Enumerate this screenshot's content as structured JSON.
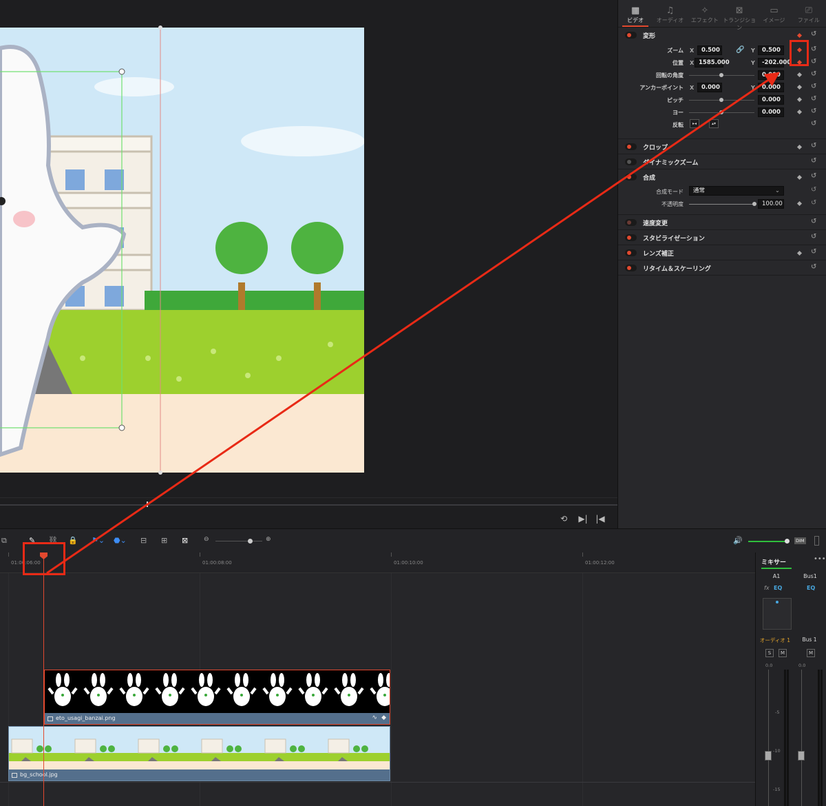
{
  "inspector": {
    "tabs": [
      {
        "label": "ビデオ",
        "icon": "film-icon",
        "active": true
      },
      {
        "label": "オーディオ",
        "icon": "music-note-icon",
        "active": false
      },
      {
        "label": "エフェクト",
        "icon": "magic-wand-icon",
        "active": false
      },
      {
        "label": "トランジション",
        "icon": "transition-icon",
        "active": false
      },
      {
        "label": "イメージ",
        "icon": "image-icon",
        "active": false
      },
      {
        "label": "ファイル",
        "icon": "file-icon",
        "active": false
      }
    ],
    "transform": {
      "title": "変形",
      "zoom_label": "ズーム",
      "zoom_x": "0.500",
      "zoom_y": "0.500",
      "position_label": "位置",
      "position_x": "1585.000",
      "position_y": "-202.000",
      "rotation_label": "回転の角度",
      "rotation": "0.000",
      "anchor_label": "アンカーポイント",
      "anchor_x": "0.000",
      "anchor_y": "0.000",
      "pitch_label": "ピッチ",
      "pitch": "0.000",
      "yaw_label": "ヨー",
      "yaw": "0.000",
      "flip_label": "反転",
      "x": "X",
      "y": "Y"
    },
    "crop": {
      "title": "クロップ"
    },
    "dynamic_zoom": {
      "title": "ダイナミックズーム"
    },
    "composite": {
      "title": "合成",
      "mode_label": "合成モード",
      "mode_value": "通常",
      "opacity_label": "不透明度",
      "opacity": "100.00"
    },
    "speed": {
      "title": "速度変更"
    },
    "stabilization": {
      "title": "スタビライゼーション"
    },
    "lens": {
      "title": "レンズ補正"
    },
    "retime": {
      "title": "リタイム＆スケーリング"
    }
  },
  "timeline": {
    "ruler": [
      "01:00:06:00",
      "01:00:08:00",
      "01:00:10:00",
      "01:00:12:00"
    ],
    "clips": {
      "v2": "eto_usagi_banzai.png",
      "v1": "bg_school.jpg"
    }
  },
  "mixer": {
    "title": "ミキサー",
    "channels": [
      "A1",
      "Bus1"
    ],
    "fx": "fx",
    "eq": "EQ",
    "strip_a1": "オーディオ 1",
    "strip_bus": "Bus 1",
    "solo": "S",
    "mute": "M",
    "level_a1": "0.0",
    "level_bus": "0.0",
    "db_marks": [
      "-5",
      "-10",
      "-15"
    ]
  },
  "toolbar": {
    "dim": "DIM"
  },
  "colors": {
    "accent": "#e2492f",
    "clip_bar": "#546f8c",
    "highlight": "#e82a16"
  }
}
